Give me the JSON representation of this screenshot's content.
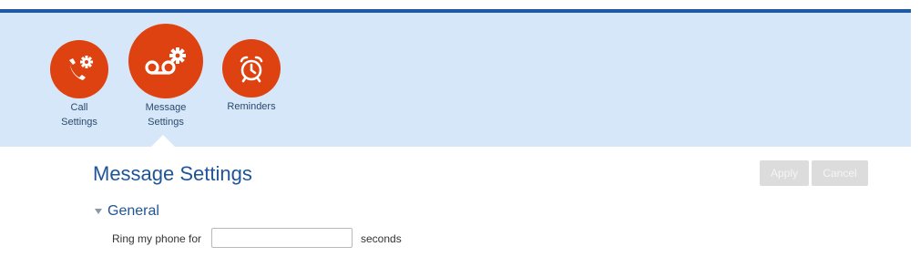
{
  "nav": {
    "items": [
      {
        "id": "call-settings",
        "label_line1": "Call",
        "label_line2": "Settings",
        "icon": "phone-gear-icon",
        "selected": false
      },
      {
        "id": "message-settings",
        "label_line1": "Message",
        "label_line2": "Settings",
        "icon": "voicemail-gear-icon",
        "selected": true
      },
      {
        "id": "reminders",
        "label_line1": "Reminders",
        "label_line2": "",
        "icon": "alarm-clock-icon",
        "selected": false
      }
    ]
  },
  "page": {
    "title": "Message Settings"
  },
  "actions": {
    "apply_label": "Apply",
    "cancel_label": "Cancel"
  },
  "general": {
    "title": "General",
    "ring_label": "Ring my phone for",
    "ring_value": "",
    "ring_unit": "seconds"
  },
  "colors": {
    "accent": "#de4210",
    "banner_bg": "#d6e7fa",
    "top_line": "#1f5aa3",
    "heading": "#1f5597",
    "button_disabled": "#dcdcdc"
  }
}
